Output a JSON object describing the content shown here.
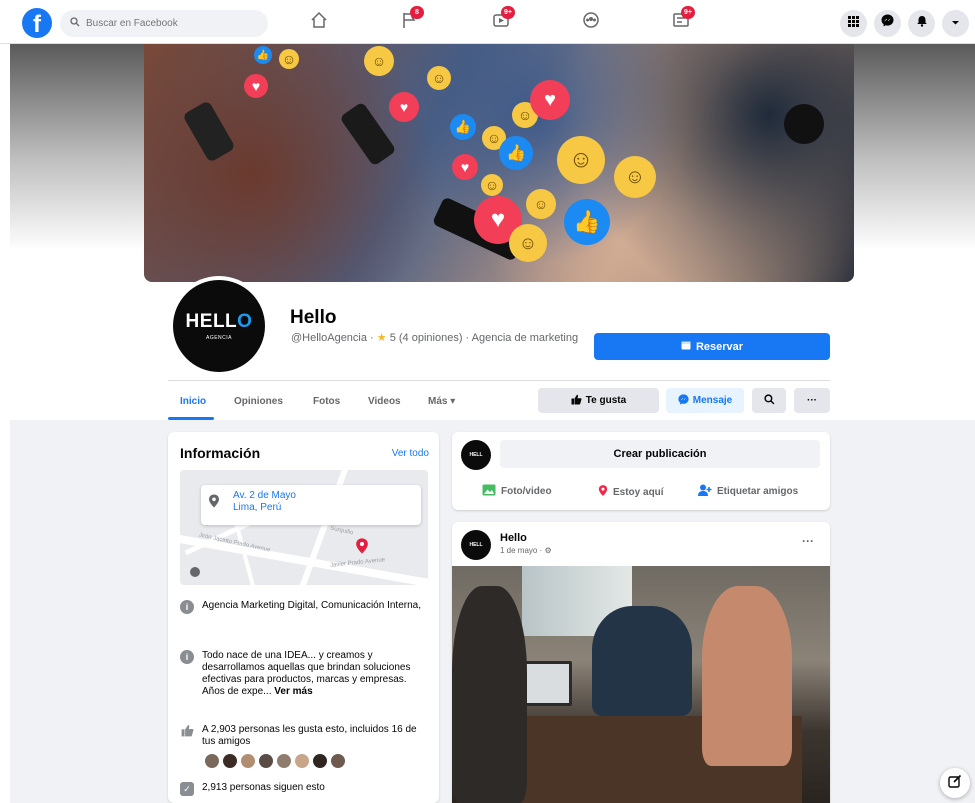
{
  "topbar": {
    "search_placeholder": "Buscar en Facebook",
    "badges": {
      "pages": "8",
      "watch": "9+",
      "gaming": "9+"
    }
  },
  "page": {
    "name": "Hello",
    "handle": "@HelloAgencia",
    "rating": "5 (4 opiniones)",
    "category": "Agencia de marketing",
    "logo_word_start": "HELL",
    "logo_word_end": "O",
    "logo_sub": "AGENCIA",
    "reserve_label": "Reservar"
  },
  "tabs": [
    {
      "label": "Inicio",
      "active": true
    },
    {
      "label": "Opiniones"
    },
    {
      "label": "Fotos"
    },
    {
      "label": "Videos"
    },
    {
      "label": "Más ▾"
    }
  ],
  "actions": {
    "like": "Te gusta",
    "message": "Mensaje"
  },
  "info": {
    "title": "Información",
    "see_all": "Ver todo",
    "address_line1": "Av. 2 de Mayo",
    "address_line2": "Lima, Perú",
    "category": "Agencia Marketing Digital, Comunicación Interna,",
    "description": "Todo nace de una IDEA... y creamos y desarrollamos aquellas que brindan soluciones efectivas para productos, marcas y empresas. Años de expe...",
    "see_more": "Ver más",
    "likes": "A 2,903 personas les gusta esto, incluidos 16 de tus amigos",
    "followers": "2,913 personas siguen esto",
    "map_street_1": "Surquillo",
    "map_street_2": "Jirón Jacinto Prado Avenue",
    "map_street_3": "Javier Prado Avenue"
  },
  "create": {
    "label": "Crear publicación",
    "photo": "Foto/video",
    "here": "Estoy aquí",
    "tag": "Etiquetar amigos"
  },
  "post": {
    "author": "Hello",
    "date": "1 de mayo"
  },
  "colors": {
    "brand": "#1877f2",
    "badge": "#e41e3f"
  }
}
